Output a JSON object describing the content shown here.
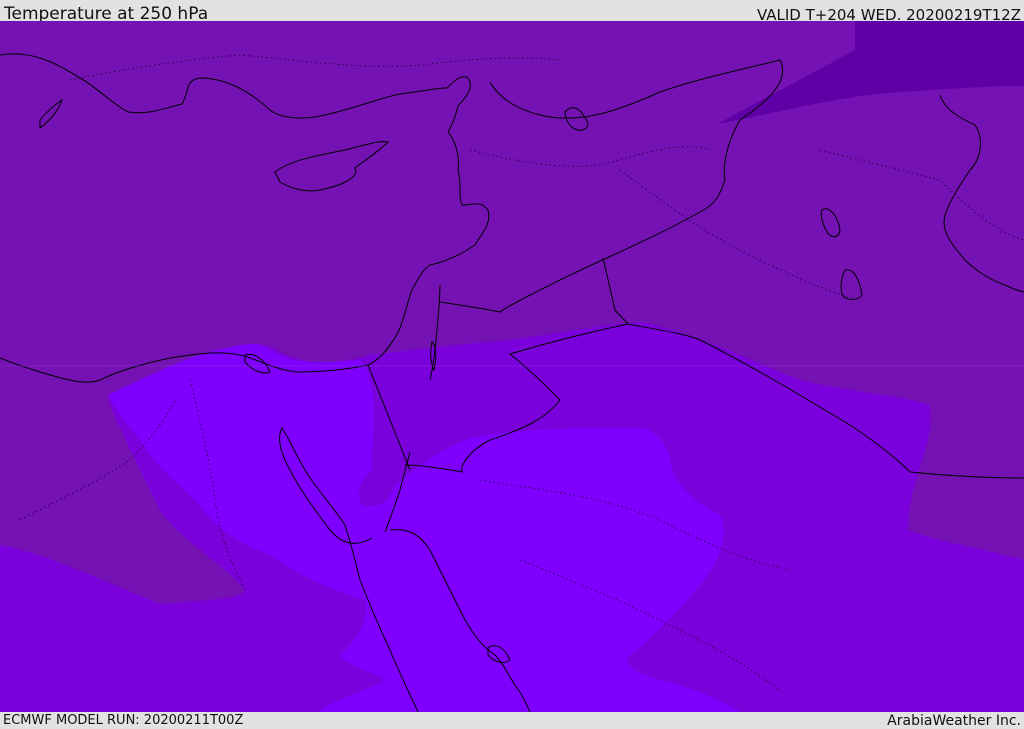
{
  "header": {
    "title": "Temperature at 250 hPa",
    "valid_time": "VALID T+204 WED. 20200219T12Z"
  },
  "footer": {
    "model_run": "ECMWF MODEL RUN: 20200211T00Z",
    "credit": "ArabiaWeather Inc."
  },
  "map": {
    "colors": {
      "band_cold": "#5f00a6",
      "band_cool": "#7412b4",
      "band_mid": "#7a00dc",
      "band_warm": "#7f00ff",
      "coastline": "#000000",
      "borders": "#000000"
    }
  }
}
